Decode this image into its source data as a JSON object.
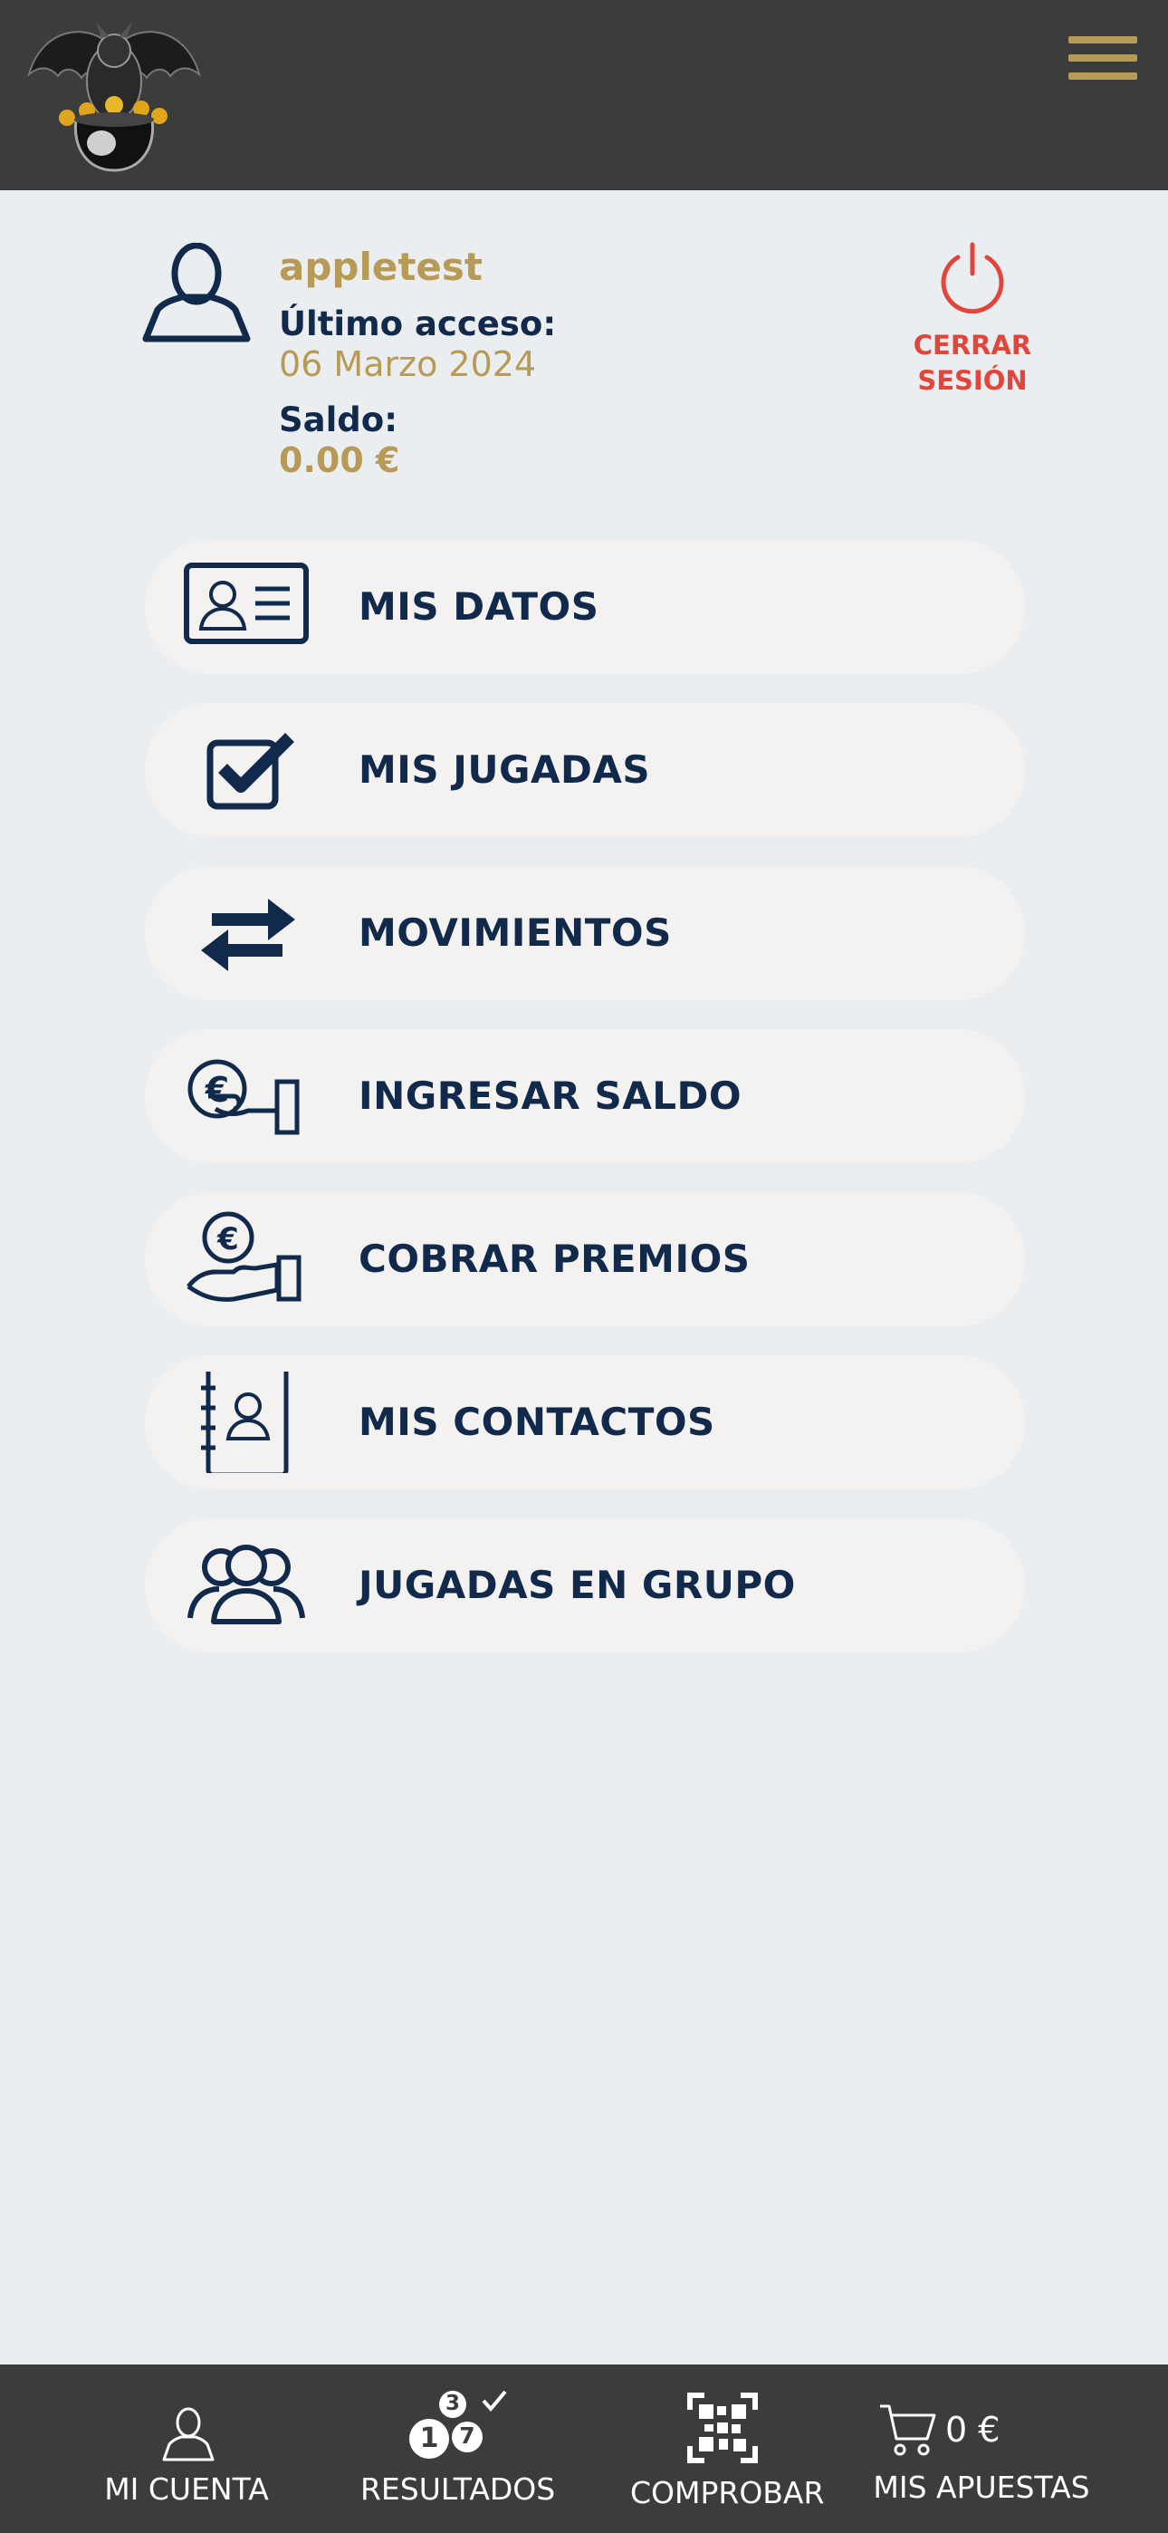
{
  "header": {
    "logo_icon": "dragon-pot-of-gold-logo",
    "menu_icon": "hamburger-icon",
    "accent_color": "#b69a55",
    "background_color": "#3b3d3d"
  },
  "account": {
    "username": "appletest",
    "last_access_label": "Último acceso:",
    "last_access_value": "06 Marzo 2024",
    "balance_label": "Saldo:",
    "balance_value": "0.00 €",
    "logout_line1": "CERRAR",
    "logout_line2": "SESIÓN",
    "logout_color": "#e2463b"
  },
  "menu": [
    {
      "label": "MIS DATOS",
      "icon": "id-card-icon"
    },
    {
      "label": "MIS JUGADAS",
      "icon": "checkbox-icon"
    },
    {
      "label": "MOVIMIENTOS",
      "icon": "swap-arrows-icon"
    },
    {
      "label": "INGRESAR SALDO",
      "icon": "hand-coin-deposit-icon"
    },
    {
      "label": "COBRAR PREMIOS",
      "icon": "hand-coin-collect-icon"
    },
    {
      "label": "MIS CONTACTOS",
      "icon": "address-book-icon"
    },
    {
      "label": "JUGADAS EN GRUPO",
      "icon": "group-users-icon"
    }
  ],
  "bottom_nav": {
    "mi_cuenta": "MI CUENTA",
    "resultados": "RESULTADOS",
    "resultados_balls": [
      "3",
      "1",
      "7"
    ],
    "comprobar": "COMPROBAR",
    "cart_amount": "0 €",
    "mis_apuestas": "MIS APUESTAS"
  }
}
